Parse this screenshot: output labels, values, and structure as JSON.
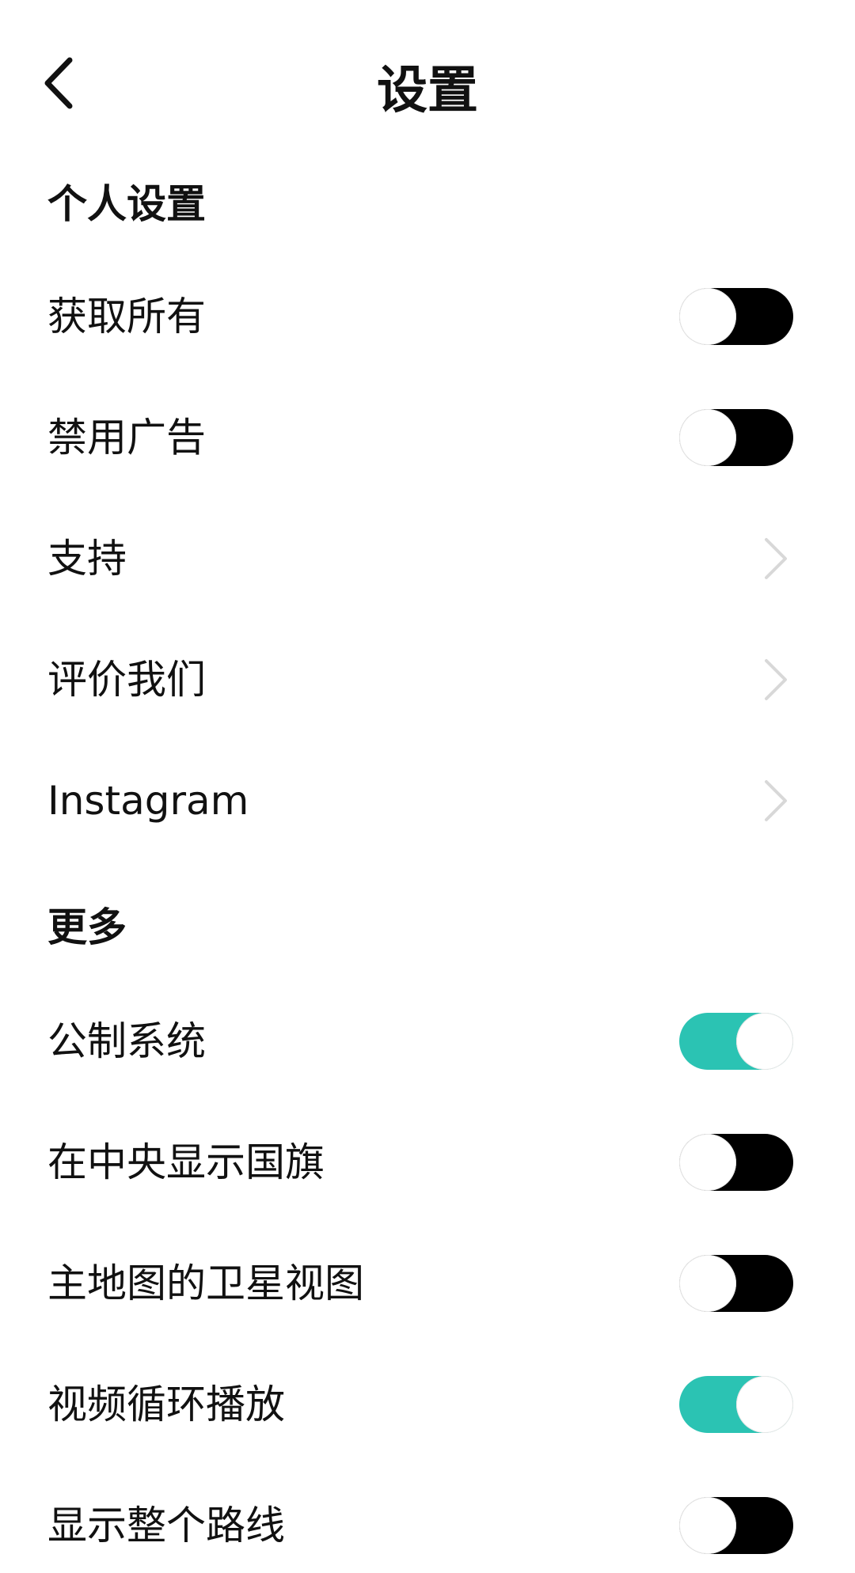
{
  "header": {
    "title": "设置"
  },
  "sections": [
    {
      "title": "个人设置",
      "items": [
        {
          "label": "获取所有",
          "control": "toggle",
          "state": "off"
        },
        {
          "label": "禁用广告",
          "control": "toggle",
          "state": "off"
        },
        {
          "label": "支持",
          "control": "chevron"
        },
        {
          "label": "评价我们",
          "control": "chevron"
        },
        {
          "label": "Instagram",
          "control": "chevron"
        }
      ]
    },
    {
      "title": "更多",
      "items": [
        {
          "label": "公制系统",
          "control": "toggle",
          "state": "on"
        },
        {
          "label": "在中央显示国旗",
          "control": "toggle",
          "state": "off"
        },
        {
          "label": "主地图的卫星视图",
          "control": "toggle",
          "state": "off"
        },
        {
          "label": "视频循环播放",
          "control": "toggle",
          "state": "on"
        },
        {
          "label": "显示整个路线",
          "control": "toggle",
          "state": "off"
        }
      ]
    }
  ],
  "colors": {
    "toggle_on": "#2bc3b3",
    "toggle_off": "#000000",
    "chevron": "#d8d8d8"
  },
  "icons": {
    "back": "chevron-left-icon",
    "row_arrow": "chevron-right-icon"
  }
}
